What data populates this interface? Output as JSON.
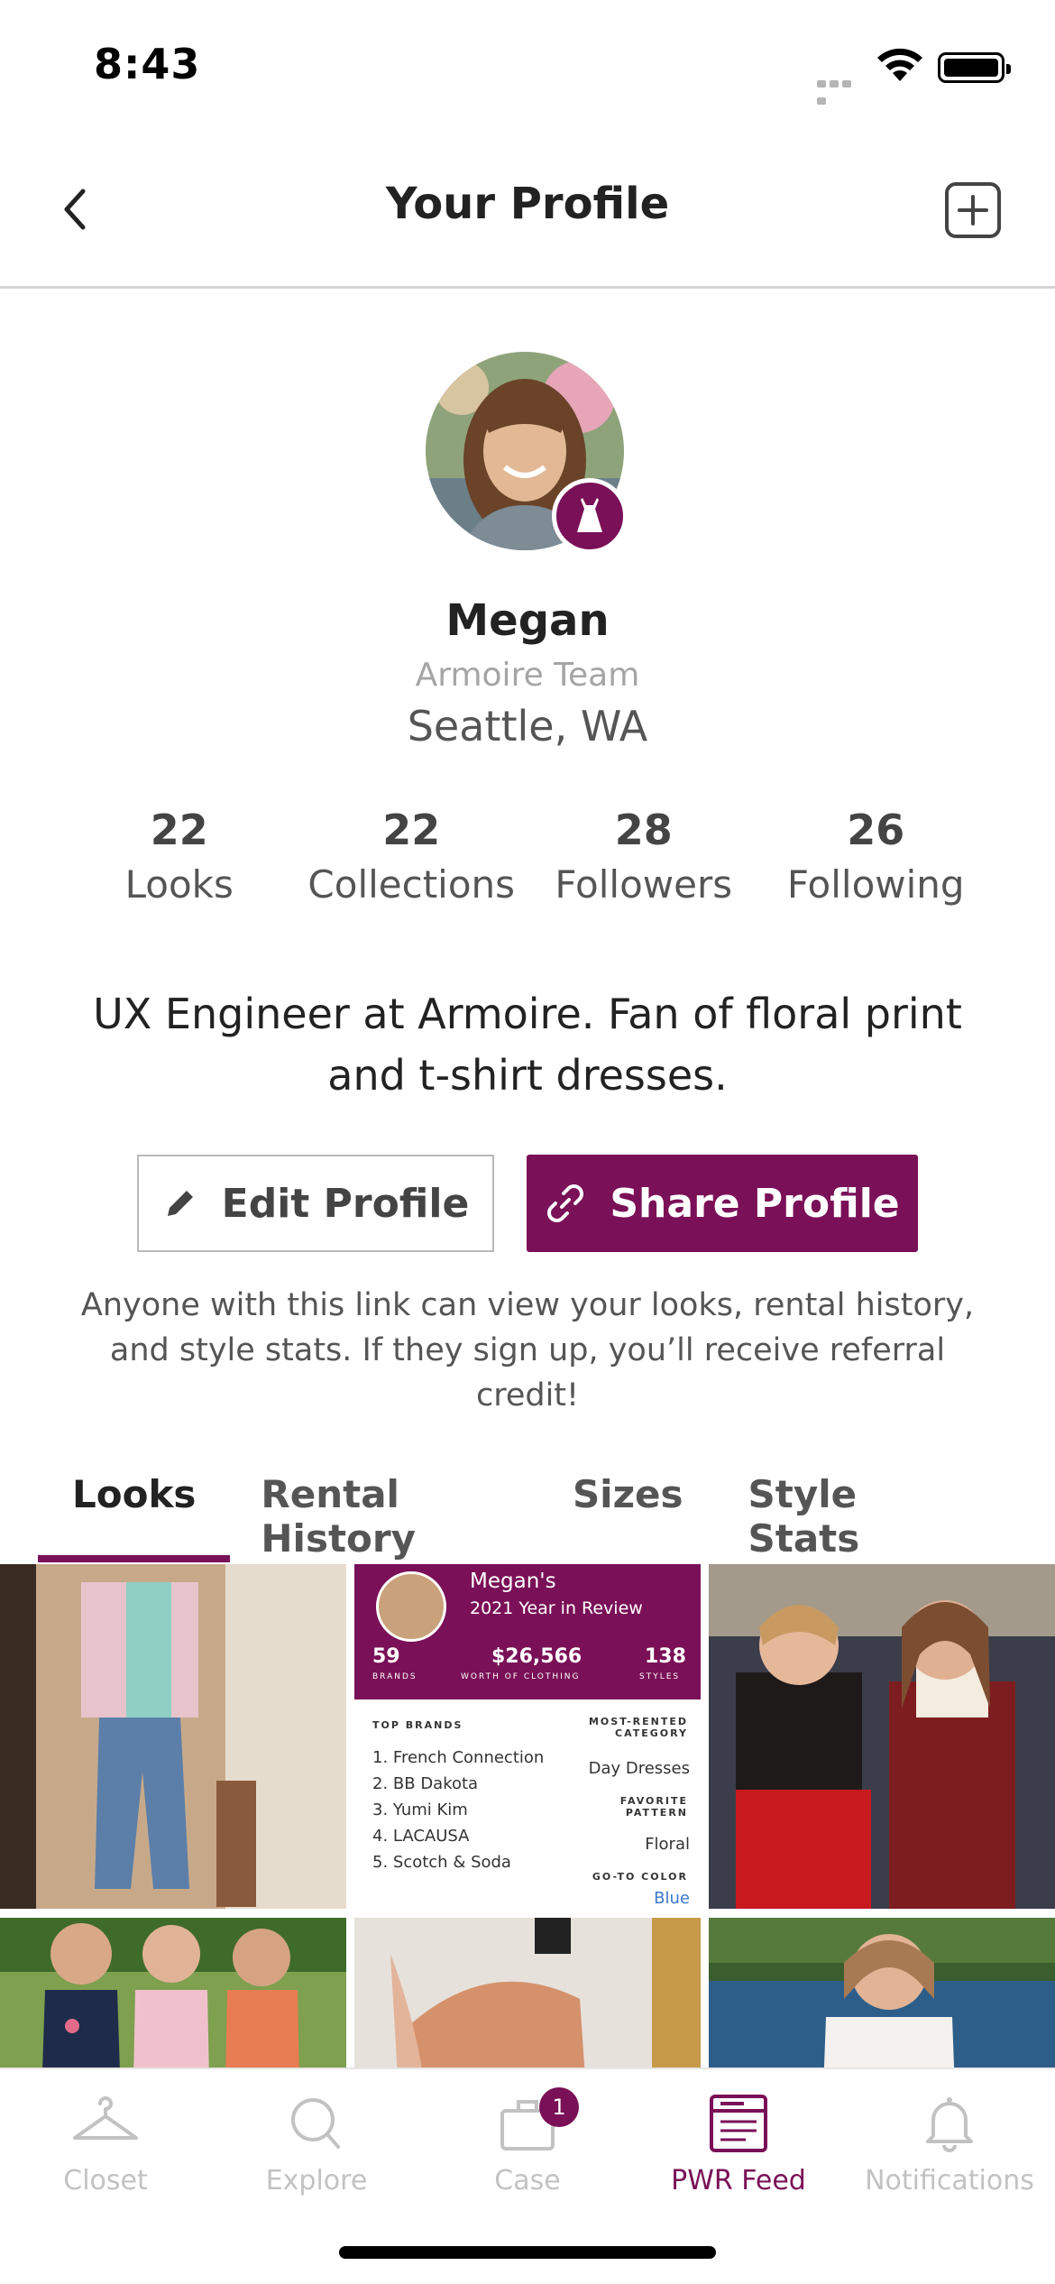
{
  "status_bar": {
    "time": "8:43"
  },
  "header": {
    "title": "Your Profile"
  },
  "profile": {
    "name": "Megan",
    "team": "Armoire Team",
    "location": "Seattle, WA",
    "bio": "UX Engineer at Armoire. Fan of floral print and t-shirt dresses."
  },
  "stats": [
    {
      "value": "22",
      "label": "Looks"
    },
    {
      "value": "22",
      "label": "Collections"
    },
    {
      "value": "28",
      "label": "Followers"
    },
    {
      "value": "26",
      "label": "Following"
    }
  ],
  "buttons": {
    "edit": "Edit Profile",
    "share": "Share Profile"
  },
  "share_note": "Anyone with this link can view your looks, rental history, and style stats. If they sign up, you’ll receive referral credit!",
  "tabs": [
    "Looks",
    "Rental History",
    "Sizes",
    "Style Stats"
  ],
  "active_tab": "Looks",
  "year_review": {
    "name": "Megan's",
    "subtitle": "2021 Year in Review",
    "brands_count": "59",
    "brands_label": "BRANDS",
    "worth": "$26,566",
    "worth_label": "WORTH OF CLOTHING",
    "styles_count": "138",
    "styles_label": "STYLES",
    "top_brands_label": "TOP BRANDS",
    "top_brands": [
      "1. French Connection",
      "2. BB Dakota",
      "3. Yumi Kim",
      "4. LACAUSA",
      "5. Scotch & Soda"
    ],
    "category_label": "MOST-RENTED CATEGORY",
    "category": "Day Dresses",
    "pattern_label": "FAVORITE PATTERN",
    "pattern": "Floral",
    "color_label": "GO-TO COLOR",
    "color": "Blue"
  },
  "tab_bar": [
    {
      "label": "Closet",
      "icon": "hanger-icon"
    },
    {
      "label": "Explore",
      "icon": "search-icon"
    },
    {
      "label": "Case",
      "icon": "suitcase-icon",
      "badge": "1"
    },
    {
      "label": "PWR Feed",
      "icon": "feed-icon"
    },
    {
      "label": "Notifications",
      "icon": "bell-icon"
    }
  ],
  "active_tab_bar": "PWR Feed",
  "colors": {
    "brand": "#7a1057",
    "inactive": "#c2c2c2"
  }
}
